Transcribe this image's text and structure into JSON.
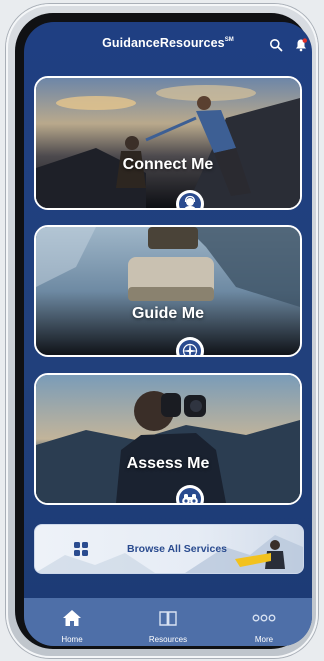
{
  "header": {
    "title": "GuidanceResources",
    "title_mark": "SM",
    "search_icon": "search-icon",
    "notification_icon": "bell-icon"
  },
  "cards": [
    {
      "title": "Connect Me",
      "badge_icon": "person-headset-icon"
    },
    {
      "title": "Guide Me",
      "badge_icon": "compass-icon"
    },
    {
      "title": "Assess Me",
      "badge_icon": "binoculars-icon"
    }
  ],
  "browse": {
    "label": "Browse All Services",
    "icon": "grid-icon"
  },
  "tabs": [
    {
      "label": "Home",
      "icon": "home-icon"
    },
    {
      "label": "Resources",
      "icon": "book-icon"
    },
    {
      "label": "More",
      "icon": "more-dots-icon"
    }
  ],
  "colors": {
    "background": "#1f3f82",
    "accent": "#2a4b8f",
    "tabbar": "#4e6fa8",
    "notification": "#e0302a"
  }
}
